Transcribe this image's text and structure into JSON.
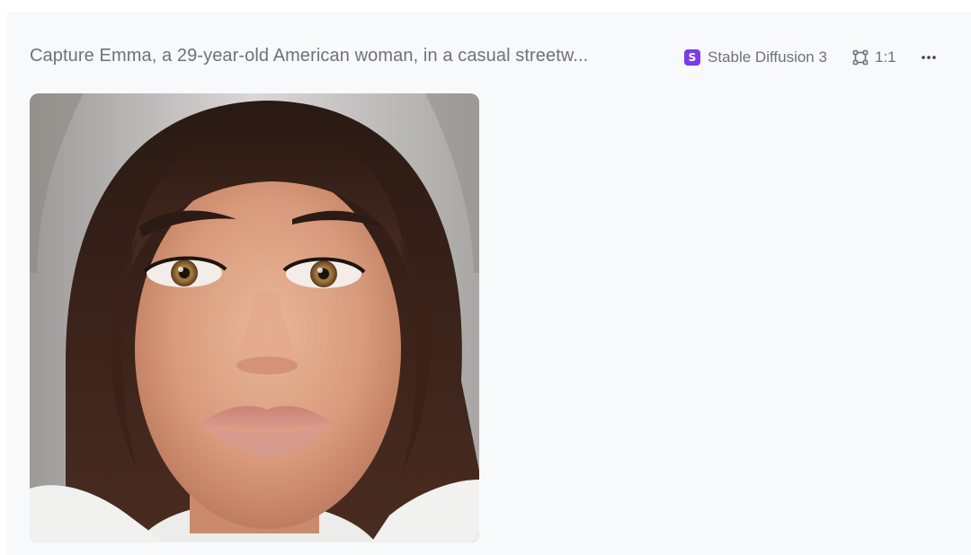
{
  "generation": {
    "prompt": "Capture Emma, a 29-year-old American woman, in a casual streetw...",
    "model_name": "Stable Diffusion 3",
    "model_logo_letter": "S",
    "aspect_ratio": "1:1",
    "more_icon": "more-horizontal-icon",
    "ratio_icon": "crop-frame-icon"
  },
  "colors": {
    "card_background": "#f7f9fb",
    "text_muted": "#6b7280",
    "model_logo_accent": "#7c3aed"
  }
}
